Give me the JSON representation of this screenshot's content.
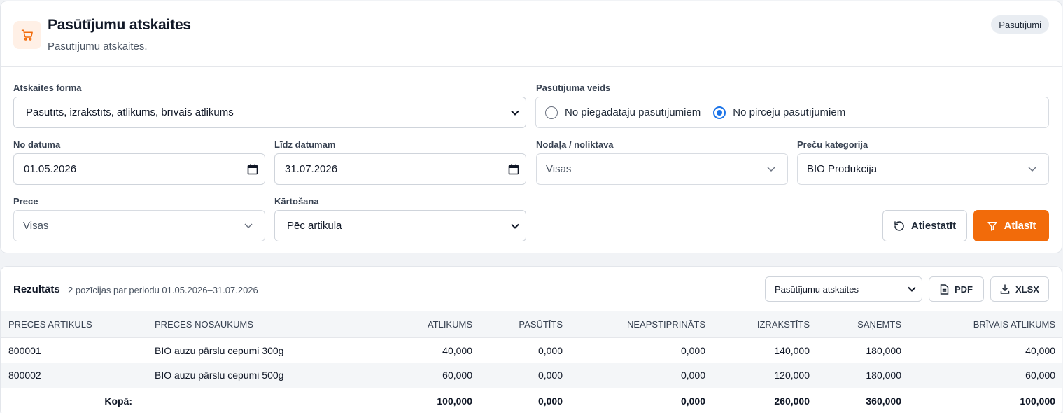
{
  "header": {
    "title": "Pasūtījumu atskaites",
    "subtitle": "Pasūtījumu atskaites.",
    "badge": "Pasūtījumi"
  },
  "filters": {
    "report_form": {
      "label": "Atskaites forma",
      "value": "Pasūtīts, izrakstīts, atlikums, brīvais atlikums"
    },
    "order_type": {
      "label": "Pasūtījuma veids",
      "options": [
        {
          "label": "No piegādātāju pasūtījumiem",
          "selected": false
        },
        {
          "label": "No pircēju pasūtījumiem",
          "selected": true
        }
      ]
    },
    "date_from": {
      "label": "No datuma",
      "value": "01.05.2026"
    },
    "date_to": {
      "label": "Līdz datumam",
      "value": "31.07.2026"
    },
    "department": {
      "label": "Nodaļa / noliktava",
      "value": "Visas"
    },
    "category": {
      "label": "Preču kategorija",
      "value": "BIO Produkcija"
    },
    "product": {
      "label": "Prece",
      "value": "Visas"
    },
    "sorting": {
      "label": "Kārtošana",
      "value": "Pēc artikula"
    },
    "reset_label": "Atiestatīt",
    "apply_label": "Atlasīt"
  },
  "results": {
    "title": "Rezultāts",
    "summary": "2 pozīcijas par periodu 01.05.2026–31.07.2026",
    "report_select": "Pasūtījumu atskaites",
    "pdf_label": "PDF",
    "xlsx_label": "XLSX",
    "columns": [
      "PRECES ARTIKULS",
      "PRECES NOSAUKUMS",
      "ATLIKUMS",
      "PASŪTĪTS",
      "NEAPSTIPRINĀTS",
      "IZRAKSTĪTS",
      "SAŅEMTS",
      "BRĪVAIS ATLIKUMS"
    ],
    "rows": [
      [
        "800001",
        "BIO auzu pārslu cepumi 300g",
        "40,000",
        "0,000",
        "0,000",
        "140,000",
        "180,000",
        "40,000"
      ],
      [
        "800002",
        "BIO auzu pārslu cepumi 500g",
        "60,000",
        "0,000",
        "0,000",
        "120,000",
        "180,000",
        "60,000"
      ]
    ],
    "total": [
      "Kopā:",
      "100,000",
      "0,000",
      "0,000",
      "260,000",
      "360,000",
      "100,000"
    ]
  },
  "colors": {
    "accent": "#f26b0a",
    "radio": "#1a73e8"
  },
  "icons": [
    "cart-icon",
    "chevron-down-icon",
    "calendar-icon",
    "reset-icon",
    "filter-icon",
    "document-icon",
    "download-icon"
  ]
}
